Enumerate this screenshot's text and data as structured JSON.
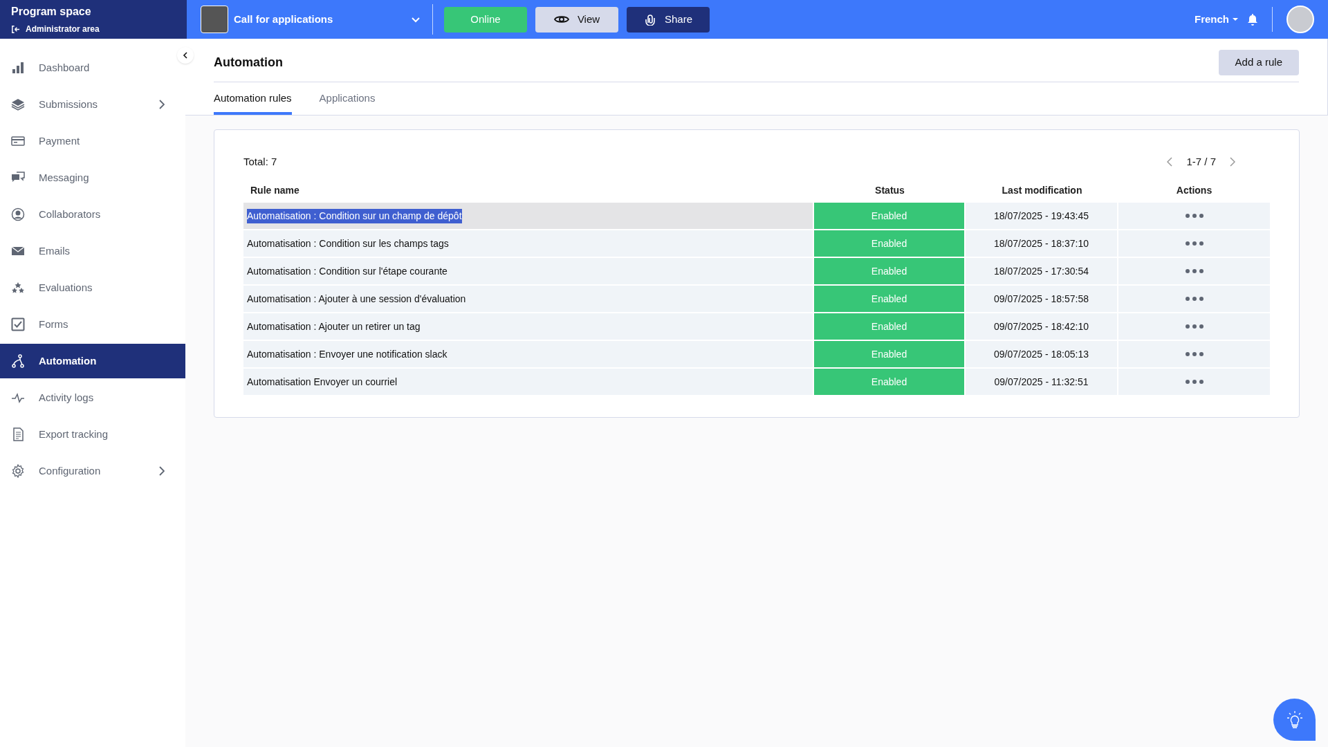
{
  "brand": {
    "title": "Program space",
    "subtitle": "Administrator area"
  },
  "topbar": {
    "program": "Call for applications",
    "online_button": "Online",
    "view_button": "View",
    "share_button": "Share",
    "language": "French"
  },
  "sidebar": {
    "items": [
      {
        "label": "Dashboard",
        "selected": false,
        "has_submenu": false
      },
      {
        "label": "Submissions",
        "selected": false,
        "has_submenu": true
      },
      {
        "label": "Payment",
        "selected": false,
        "has_submenu": false
      },
      {
        "label": "Messaging",
        "selected": false,
        "has_submenu": false
      },
      {
        "label": "Collaborators",
        "selected": false,
        "has_submenu": false
      },
      {
        "label": "Emails",
        "selected": false,
        "has_submenu": false
      },
      {
        "label": "Evaluations",
        "selected": false,
        "has_submenu": false
      },
      {
        "label": "Forms",
        "selected": false,
        "has_submenu": false
      },
      {
        "label": "Automation",
        "selected": true,
        "has_submenu": false
      },
      {
        "label": "Activity logs",
        "selected": false,
        "has_submenu": false
      },
      {
        "label": "Export tracking",
        "selected": false,
        "has_submenu": false
      },
      {
        "label": "Configuration",
        "selected": false,
        "has_submenu": true
      }
    ]
  },
  "page": {
    "title": "Automation",
    "add_button": "Add a rule"
  },
  "tabs": [
    {
      "label": "Automation rules",
      "selected": true
    },
    {
      "label": "Applications",
      "selected": false
    }
  ],
  "table": {
    "total": "Total: 7",
    "pagination": "1-7 / 7",
    "columns": [
      "Rule name",
      "Status",
      "Last modification",
      "Actions"
    ],
    "rows": [
      {
        "name": "Automatisation : Condition sur un champ de dépôt",
        "status": "Enabled",
        "kind": "enabled",
        "modified": "18/07/2025 - 19:43:45",
        "selected": true
      },
      {
        "name": "Automatisation : Condition sur les champs tags",
        "status": "Enabled",
        "kind": "enabled",
        "modified": "18/07/2025 - 18:37:10",
        "selected": false
      },
      {
        "name": "Automatisation : Condition sur l'étape courante",
        "status": "Enabled",
        "kind": "enabled",
        "modified": "18/07/2025 - 17:30:54",
        "selected": false
      },
      {
        "name": "Automatisation : Ajouter à une session d'évaluation",
        "status": "Enabled",
        "kind": "enabled",
        "modified": "09/07/2025 - 18:57:58",
        "selected": false
      },
      {
        "name": "Automatisation : Ajouter un retirer un tag",
        "status": "Enabled",
        "kind": "enabled",
        "modified": "09/07/2025 - 18:42:10",
        "selected": false
      },
      {
        "name": "Automatisation : Envoyer une notification slack",
        "status": "Enabled",
        "kind": "enabled",
        "modified": "09/07/2025 - 18:05:13",
        "selected": false
      },
      {
        "name": "Automatisation Envoyer un courriel",
        "status": "Enabled",
        "kind": "enabled",
        "modified": "09/07/2025 - 11:32:51",
        "selected": false
      }
    ]
  }
}
